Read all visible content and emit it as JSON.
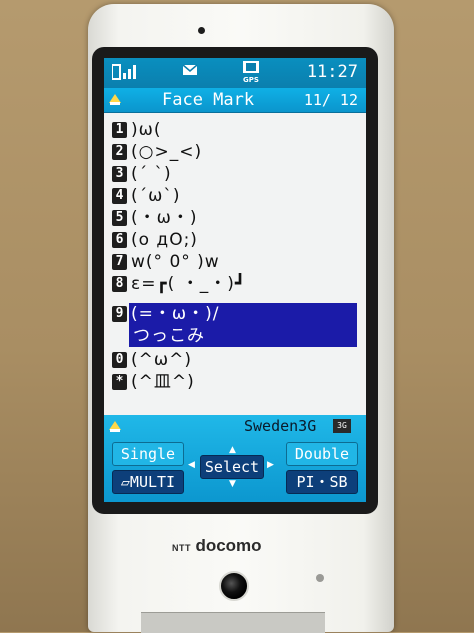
{
  "brand": {
    "ntt": "NTT",
    "docomo": "docomo"
  },
  "statusbar": {
    "time": "11:27",
    "icons": [
      "signal-icon",
      "mail-icon",
      "gps-icon"
    ],
    "gps_label": "GPS"
  },
  "titlebar": {
    "title": "Face Mark",
    "page": "11/ 12"
  },
  "list": {
    "items": [
      {
        "key": "1",
        "face": ")ω("
      },
      {
        "key": "2",
        "face": "(○>_<)"
      },
      {
        "key": "3",
        "face": "(´ `)"
      },
      {
        "key": "4",
        "face": "(´ω`)"
      },
      {
        "key": "5",
        "face": "(・ω・)"
      },
      {
        "key": "6",
        "face": "(o дO;)"
      },
      {
        "key": "7",
        "face": "w(° 0° )w"
      },
      {
        "key": "8",
        "face": "ε=┏( ・_・)┛"
      },
      {
        "key": "9",
        "face": "(=・ω・)/",
        "sub": "つっこみ",
        "selected": true
      },
      {
        "key": "0",
        "face": "(^ω^)"
      },
      {
        "key": "*",
        "face": "(^皿^)"
      }
    ]
  },
  "bottombar": {
    "network": "Sweden3G",
    "network_badge": "3G",
    "softkeys": {
      "single": "Single",
      "multi": "▱MULTI",
      "select": "Select",
      "double": "Double",
      "pisb": "PI・SB"
    }
  },
  "colors": {
    "header": "#0b95cc",
    "selection": "#1b1ba8",
    "softkey_dark": "#0d3f7a"
  }
}
